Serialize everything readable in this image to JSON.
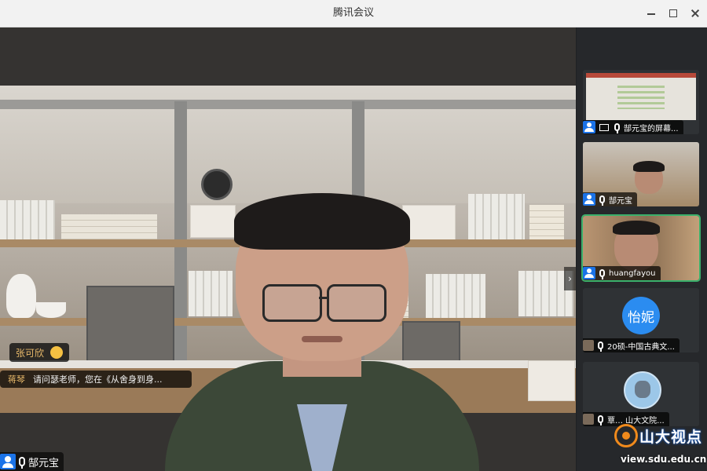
{
  "window": {
    "title": "腾讯会议"
  },
  "chat": {
    "sender1": "张可欣",
    "sender2": "蒋琴",
    "message": "请问瑟老师，您在《从舍身到身..."
  },
  "main_video": {
    "speaker_name": "郜元宝"
  },
  "sidebar": {
    "tiles": [
      {
        "label": "郜元宝的屏幕...",
        "type": "screen-share"
      },
      {
        "label": "郜元宝",
        "type": "camera"
      },
      {
        "label": "huangfayou",
        "type": "camera",
        "active": true
      },
      {
        "label": "20硕-中国古典文...",
        "avatar_text": "怡妮",
        "type": "avatar"
      },
      {
        "label": "覃…  山大文院...",
        "type": "avatar-image"
      }
    ]
  },
  "watermark": {
    "brand": "山大视点",
    "url": "view.sdu.edu.cn"
  },
  "colors": {
    "accent_blue": "#1b73e8",
    "active_green": "#3ab06b",
    "chat_name": "#e8b96a",
    "watermark_orange": "#f08a1c"
  }
}
